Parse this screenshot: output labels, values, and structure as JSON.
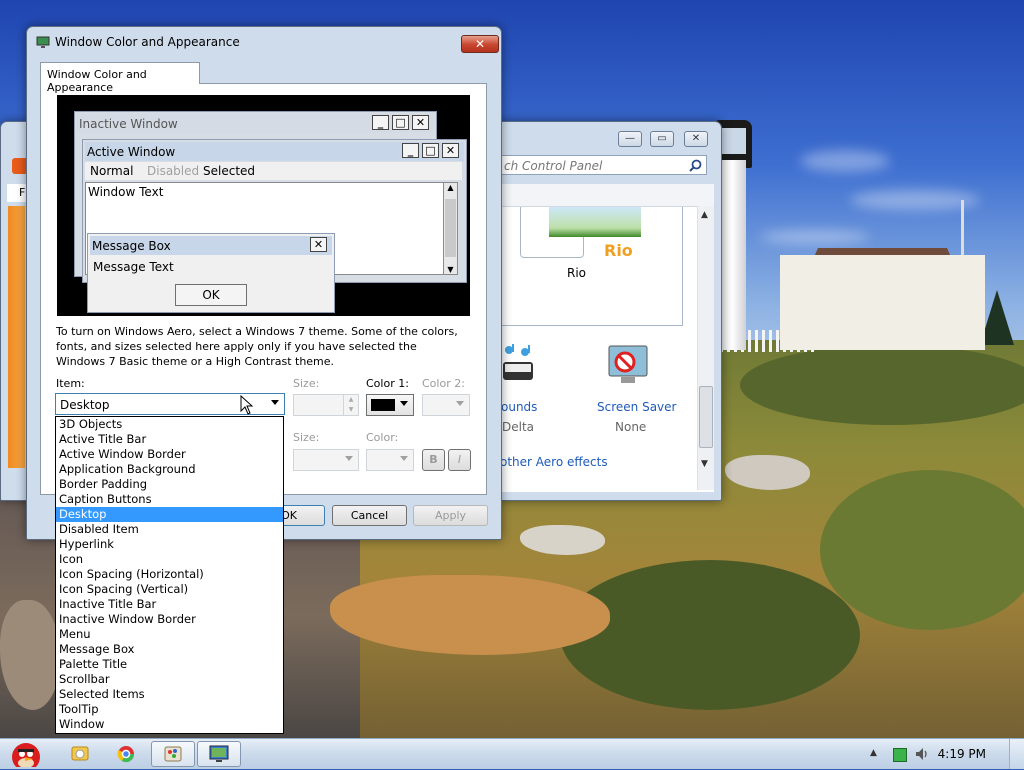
{
  "dialog": {
    "title": "Window Color and Appearance",
    "tab": "Window Color and Appearance",
    "preview": {
      "inactive_title": "Inactive Window",
      "active_title": "Active Window",
      "menu_normal": "Normal",
      "menu_disabled": "Disabled",
      "menu_selected": "Selected",
      "window_text": "Window Text",
      "msgbox_title": "Message Box",
      "msgbox_text": "Message Text",
      "msgbox_ok": "OK"
    },
    "description": "To turn on Windows Aero, select a Windows 7 theme.  Some of the colors, fonts, and sizes selected here apply only if you have selected the Windows 7 Basic theme or a High Contrast theme.",
    "item_label": "Item:",
    "item_value": "Desktop",
    "size_label": "Size:",
    "color1_label": "Color 1:",
    "color2_label": "Color 2:",
    "color1_value": "#000000",
    "font_size_label": "Size:",
    "font_color_label": "Color:",
    "bold_label": "B",
    "italic_label": "I",
    "ok_label": "OK",
    "cancel_label": "Cancel",
    "apply_label": "Apply",
    "item_options": [
      "3D Objects",
      "Active Title Bar",
      "Active Window Border",
      "Application Background",
      "Border Padding",
      "Caption Buttons",
      "Desktop",
      "Disabled Item",
      "Hyperlink",
      "Icon",
      "Icon Spacing (Horizontal)",
      "Icon Spacing (Vertical)",
      "Inactive Title Bar",
      "Inactive Window Border",
      "Menu",
      "Message Box",
      "Palette Title",
      "Scrollbar",
      "Selected Items",
      "ToolTip",
      "Window"
    ],
    "selected_option": "Desktop"
  },
  "control_panel": {
    "search_placeholder": "ch Control Panel",
    "theme_name": "Rio",
    "sounds_label": "ounds",
    "sounds_value": "Delta",
    "screensaver_label": "Screen Saver",
    "screensaver_value": "None",
    "aero_link": "other Aero effects"
  },
  "left_window": {
    "menu_letter": "F"
  },
  "taskbar": {
    "time": "4:19 PM",
    "items": [
      "angry-birds-icon",
      "windows-explorer-icon",
      "chrome-icon",
      "paint-icon",
      "display-settings-icon"
    ]
  }
}
